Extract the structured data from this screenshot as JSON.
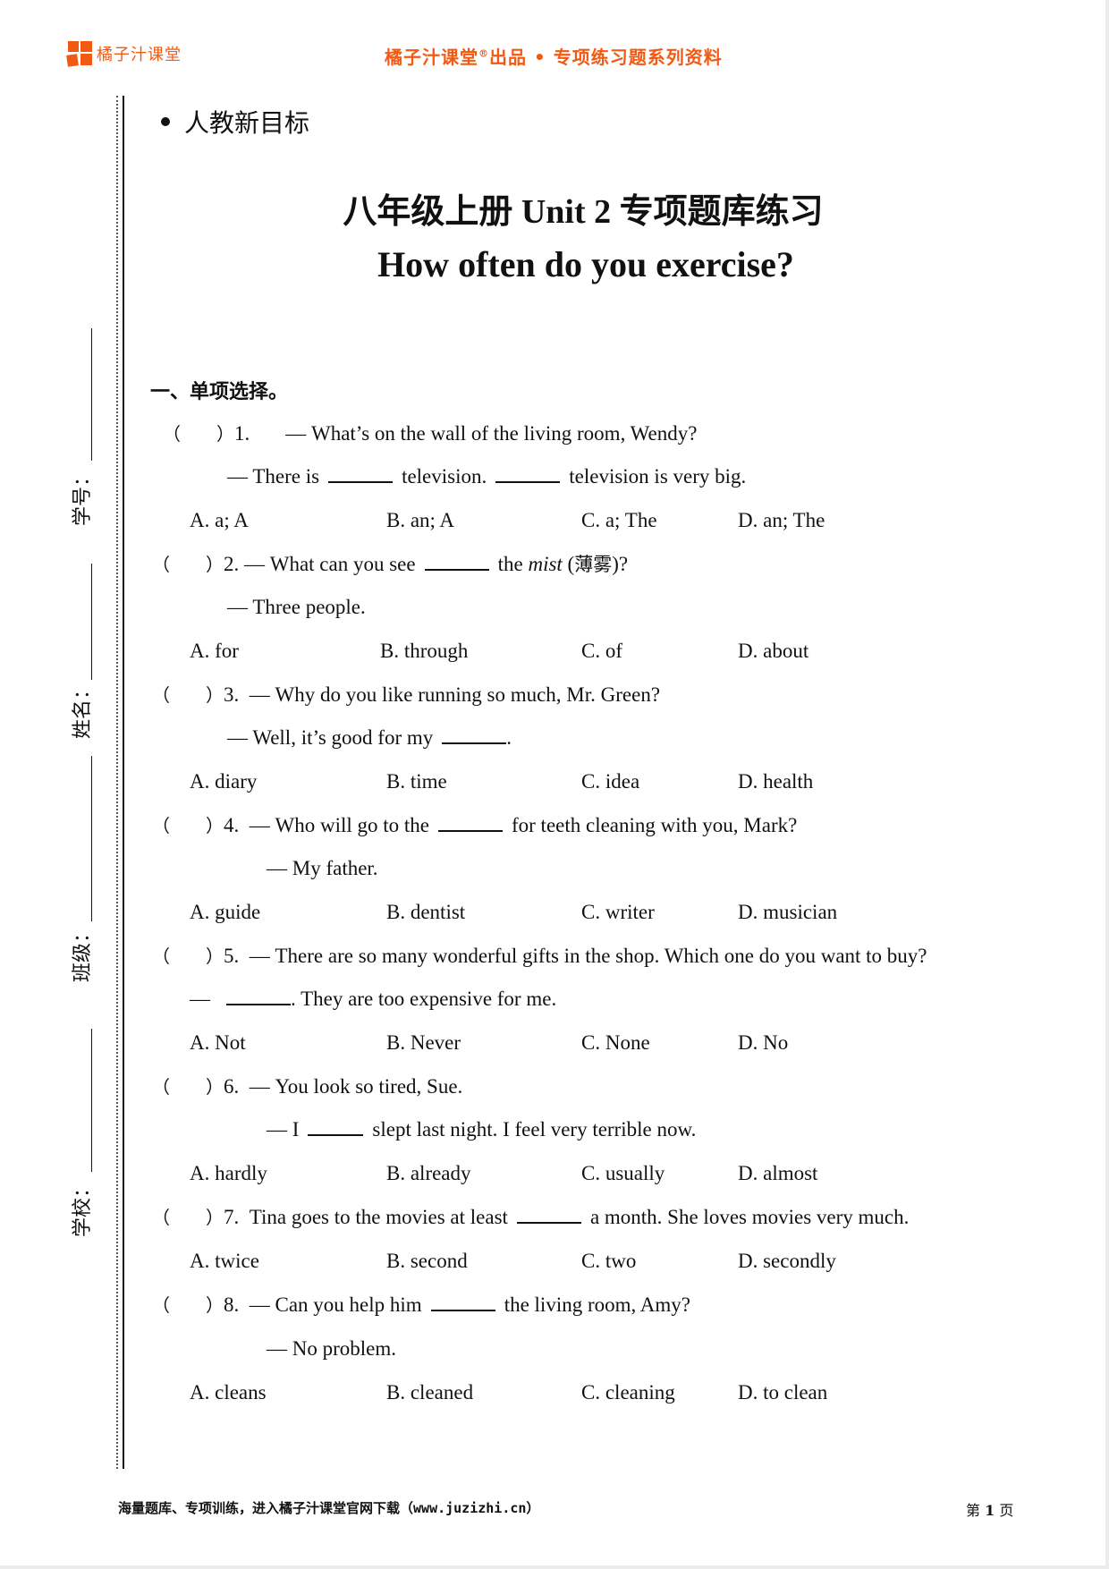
{
  "header": {
    "brand_name": "橘子汁课堂",
    "series_title_prefix": "橘子汁课堂",
    "registered_mark": "®",
    "series_title_suffix": "出品 • 专项练习题系列资料",
    "accent_color": "#f25a13"
  },
  "side_fields": [
    {
      "label": "学号："
    },
    {
      "label": "姓名："
    },
    {
      "label": "班级："
    },
    {
      "label": "学校："
    }
  ],
  "tag": "人教新目标",
  "title": {
    "zh_left": "八年级上册",
    "en_mid": " Unit 2 ",
    "zh_right": " 专项题库练习",
    "subtitle": "How often do you exercise?"
  },
  "section_title": "一、单项选择。",
  "questions": [
    {
      "paren": "（　　）",
      "number": "1.",
      "line1_pre": "— What’s on the wall of the living room, Wendy?",
      "line2_pre": "— There is",
      "line2_mid": "television.",
      "line2_post": "television is very big.",
      "options": [
        "A. a; A",
        "B. an; A",
        "C. a; The",
        "D. an; The"
      ]
    },
    {
      "paren": "（　　）",
      "number": "2.",
      "line1_pre": "— What can you see",
      "line1_post_a": "the ",
      "line1_italic": "mist",
      "line1_post_b": " (",
      "line1_zh": "薄雾",
      "line1_post_c": ")?",
      "line2": "— Three people.",
      "options": [
        "A. for",
        "B. through",
        "C. of",
        "D. about"
      ]
    },
    {
      "paren": "（　　）",
      "number": "3.",
      "line1": "— Why do you like running so much, Mr. Green?",
      "line2_pre": "— Well, it’s good for my",
      "line2_post": ".",
      "options": [
        "A. diary",
        "B. time",
        "C. idea",
        "D. health"
      ]
    },
    {
      "paren": "（　　）",
      "number": "4.",
      "line1_pre": "— Who will go to the",
      "line1_post": "for teeth cleaning with you, Mark?",
      "line2": "— My father.",
      "options": [
        "A. guide",
        "B. dentist",
        "C. writer",
        "D. musician"
      ]
    },
    {
      "paren": "（　　）",
      "number": "5.",
      "line1": "— There are so many wonderful gifts in the shop. Which one do you want to buy?",
      "line2_pre": "—",
      "line2_post": ". They are too expensive for me.",
      "options": [
        "A. Not",
        "B. Never",
        "C. None",
        "D. No"
      ]
    },
    {
      "paren": "（　　）",
      "number": "6.",
      "line1": "— You look so tired, Sue.",
      "line2_pre": "— I",
      "line2_post": "slept last night. I feel very terrible now.",
      "options": [
        "A. hardly",
        "B. already",
        "C. usually",
        "D. almost"
      ]
    },
    {
      "paren": "（　　）",
      "number": "7.",
      "line1_pre": "Tina goes to the movies at least",
      "line1_post": "a month. She loves movies very much.",
      "options": [
        "A. twice",
        "B. second",
        "C. two",
        "D. secondly"
      ]
    },
    {
      "paren": "（　　）",
      "number": "8.",
      "line1_pre": "— Can you help him",
      "line1_post": "the living room, Amy?",
      "line2": "— No problem.",
      "options": [
        "A. cleans",
        "B. cleaned",
        "C. cleaning",
        "D. to clean"
      ]
    }
  ],
  "footer": {
    "left": "海量题库、专项训练，进入橘子汁课堂官网下载（www.juzizhi.cn）",
    "page_prefix": "第 ",
    "page_number": "1",
    "page_suffix": " 页"
  }
}
